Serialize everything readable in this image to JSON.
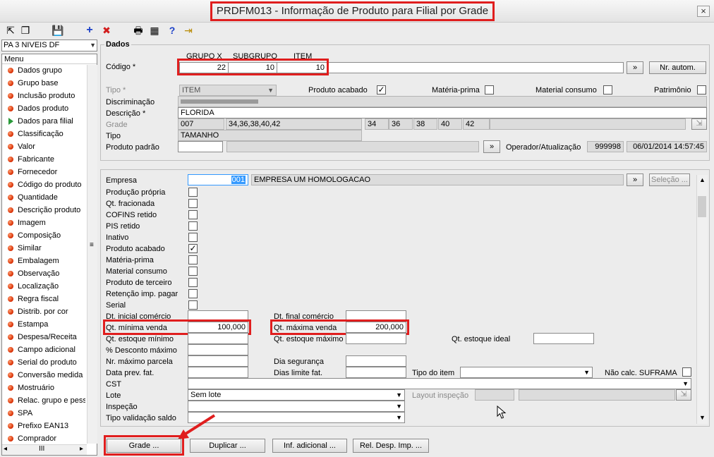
{
  "window": {
    "title": "PRDFM013 - Informação de Produto para Filial por Grade",
    "close": "×"
  },
  "toolbar": {
    "icons": [
      "export-icon",
      "copy-icon",
      "save-icon",
      "add-icon",
      "delete-icon",
      "print-icon",
      "calculator-icon",
      "help-icon",
      "exit-icon"
    ],
    "glyphs": [
      "⇱",
      "❐",
      "💾",
      "+",
      "✖",
      "🖶",
      "▦",
      "?",
      "⇥"
    ]
  },
  "left": {
    "combo_value": "PA 3 NIVEIS DF",
    "menu_header": "Menu",
    "items": [
      "Dados grupo",
      "Grupo base",
      "Inclusão produto",
      "Dados produto",
      "Dados para filial",
      "Classificação",
      "Valor",
      "Fabricante",
      "Fornecedor",
      "Código do produto",
      "Quantidade",
      "Descrição produto",
      "Imagem",
      "Composição",
      "Similar",
      "Embalagem",
      "Observação",
      "Localização",
      "Regra fiscal",
      "Distrib. por cor",
      "Estampa",
      "Despesa/Receita",
      "Campo adicional",
      "Serial do produto",
      "Conversão medida",
      "Mostruário",
      "Relac. grupo e pess",
      "SPA",
      "Prefixo EAN13",
      "Comprador"
    ],
    "active_item": "Dados para filial"
  },
  "dados": {
    "legend": "Dados",
    "codigo_label": "Código *",
    "col_headers": [
      "GRUPO X",
      "SUBGRUPO",
      "ITEM"
    ],
    "codigo_values": [
      "22",
      "10",
      "10"
    ],
    "nav_btn": "»",
    "nr_autom": "Nr. autom.",
    "tipo_label": "Tipo *",
    "tipo_value": "ITEM",
    "produto_acabado_label": "Produto acabado",
    "materia_prima_label": "Matéria-prima",
    "material_consumo_label": "Material consumo",
    "patrimonio_label": "Patrimônio",
    "discriminacao_label": "Discriminação",
    "descricao_label": "Descrição *",
    "descricao_value": "FLORIDA",
    "grade_label": "Grade",
    "grade_code": "007",
    "grade_list": "34,36,38,40,42",
    "grade_sizes": [
      "34",
      "36",
      "38",
      "40",
      "42"
    ],
    "tipo2_label": "Tipo",
    "tipo2_value": "TAMANHO",
    "produto_padrao_label": "Produto padrão",
    "operador_label": "Operador/Atualização",
    "operador_value": "999998",
    "data_atualizacao": "06/01/2014 14:57:45"
  },
  "filial": {
    "empresa_label": "Empresa",
    "empresa_code": "001",
    "empresa_name": "EMPRESA UM  HOMOLOGACAO",
    "selecao_btn": "Seleção ...",
    "checks": [
      {
        "label": "Produção própria",
        "checked": false
      },
      {
        "label": "Qt. fracionada",
        "checked": false
      },
      {
        "label": "COFINS retido",
        "checked": false
      },
      {
        "label": "PIS retido",
        "checked": false
      },
      {
        "label": "Inativo",
        "checked": false
      },
      {
        "label": "Produto acabado",
        "checked": true
      },
      {
        "label": "Matéria-prima",
        "checked": false
      },
      {
        "label": "Material consumo",
        "checked": false
      },
      {
        "label": "Produto de terceiro",
        "checked": false
      },
      {
        "label": "Retenção imp. pagar",
        "checked": false
      },
      {
        "label": "Serial",
        "checked": false
      }
    ],
    "dt_inicial_label": "Dt. inicial comércio",
    "dt_final_label": "Dt. final comércio",
    "qt_minima_label": "Qt. mínima venda",
    "qt_minima_value": "100,000",
    "qt_maxima_label": "Qt. máxima venda",
    "qt_maxima_value": "200,000",
    "qt_est_min_label": "Qt. estoque mínimo",
    "qt_est_max_label": "Qt. estoque máximo",
    "qt_est_ideal_label": "Qt. estoque ideal",
    "desc_max_label": "% Desconto máximo",
    "nr_max_parcela_label": "Nr. máximo parcela",
    "dia_seguranca_label": "Dia segurança",
    "data_prev_fat_label": "Data prev. fat.",
    "dias_limite_label": "Dias limite fat.",
    "tipo_item_label": "Tipo do item",
    "nao_calc_label": "Não calc. SUFRAMA",
    "cst_label": "CST",
    "lote_label": "Lote",
    "lote_value": "Sem lote",
    "layout_inspecao_label": "Layout inspeção",
    "inspecao_label": "Inspeção",
    "tipo_validacao_label": "Tipo validação saldo"
  },
  "buttons": {
    "grade": "Grade ...",
    "duplicar": "Duplicar ...",
    "inf_adicional": "Inf. adicional ...",
    "rel_desp": "Rel. Desp. Imp. ..."
  },
  "colors": {
    "highlight": "#e01e1e",
    "empresa_code_bg": "#3399ff"
  }
}
